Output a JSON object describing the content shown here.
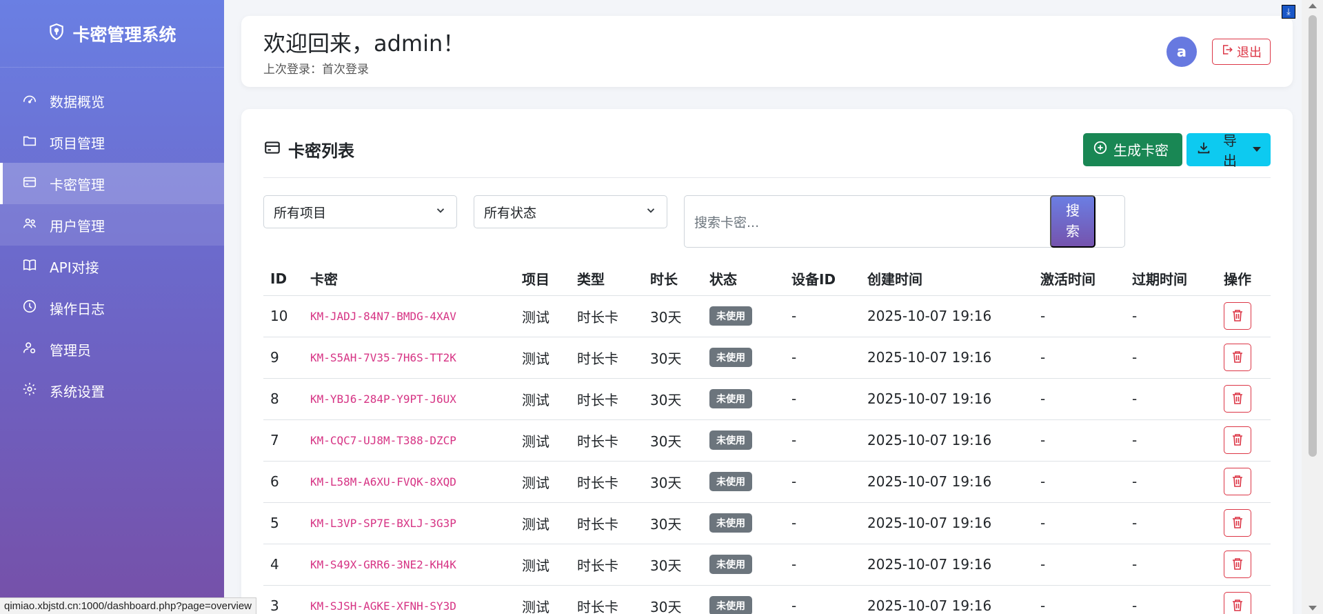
{
  "sidebar": {
    "brand": "卡密管理系统",
    "items": [
      {
        "label": "数据概览",
        "icon": "speedometer-icon"
      },
      {
        "label": "项目管理",
        "icon": "folder-icon"
      },
      {
        "label": "卡密管理",
        "icon": "card-icon"
      },
      {
        "label": "用户管理",
        "icon": "people-icon"
      },
      {
        "label": "API对接",
        "icon": "book-icon"
      },
      {
        "label": "操作日志",
        "icon": "clock-icon"
      },
      {
        "label": "管理员",
        "icon": "admin-icon"
      },
      {
        "label": "系统设置",
        "icon": "gear-icon"
      }
    ]
  },
  "topbar": {
    "welcome": "欢迎回来，admin！",
    "last_login": "上次登录：首次登录",
    "avatar_letter": "a",
    "logout_label": "退出"
  },
  "card": {
    "title": "卡密列表",
    "generate_label": "生成卡密",
    "export_label": "导出"
  },
  "filters": {
    "project_select": "所有项目",
    "status_select": "所有状态",
    "search_placeholder": "搜索卡密...",
    "search_button": "搜索"
  },
  "table": {
    "columns": [
      "ID",
      "卡密",
      "项目",
      "类型",
      "时长",
      "状态",
      "设备ID",
      "创建时间",
      "激活时间",
      "过期时间",
      "操作"
    ],
    "rows": [
      {
        "id": "10",
        "code": "KM-JADJ-84N7-BMDG-4XAV",
        "project": "测试",
        "type": "时长卡",
        "duration": "30天",
        "status": "未使用",
        "device": "-",
        "created": "2025-10-07 19:16",
        "activated": "-",
        "expires": "-"
      },
      {
        "id": "9",
        "code": "KM-S5AH-7V35-7H6S-TT2K",
        "project": "测试",
        "type": "时长卡",
        "duration": "30天",
        "status": "未使用",
        "device": "-",
        "created": "2025-10-07 19:16",
        "activated": "-",
        "expires": "-"
      },
      {
        "id": "8",
        "code": "KM-YBJ6-284P-Y9PT-J6UX",
        "project": "测试",
        "type": "时长卡",
        "duration": "30天",
        "status": "未使用",
        "device": "-",
        "created": "2025-10-07 19:16",
        "activated": "-",
        "expires": "-"
      },
      {
        "id": "7",
        "code": "KM-CQC7-UJ8M-T388-DZCP",
        "project": "测试",
        "type": "时长卡",
        "duration": "30天",
        "status": "未使用",
        "device": "-",
        "created": "2025-10-07 19:16",
        "activated": "-",
        "expires": "-"
      },
      {
        "id": "6",
        "code": "KM-L58M-A6XU-FVQK-8XQD",
        "project": "测试",
        "type": "时长卡",
        "duration": "30天",
        "status": "未使用",
        "device": "-",
        "created": "2025-10-07 19:16",
        "activated": "-",
        "expires": "-"
      },
      {
        "id": "5",
        "code": "KM-L3VP-SP7E-BXLJ-3G3P",
        "project": "测试",
        "type": "时长卡",
        "duration": "30天",
        "status": "未使用",
        "device": "-",
        "created": "2025-10-07 19:16",
        "activated": "-",
        "expires": "-"
      },
      {
        "id": "4",
        "code": "KM-S49X-GRR6-3NE2-KH4K",
        "project": "测试",
        "type": "时长卡",
        "duration": "30天",
        "status": "未使用",
        "device": "-",
        "created": "2025-10-07 19:16",
        "activated": "-",
        "expires": "-"
      },
      {
        "id": "3",
        "code": "KM-SJSH-AGKE-XFNH-SY3D",
        "project": "测试",
        "type": "时长卡",
        "duration": "30天",
        "status": "未使用",
        "device": "-",
        "created": "2025-10-07 19:16",
        "activated": "-",
        "expires": "-"
      }
    ]
  },
  "status_bar": {
    "url": "qimiao.xbjstd.cn:1000/dashboard.php?page=overview"
  },
  "colors": {
    "sidebar_top": "#6a7fe3",
    "sidebar_bottom": "#7650a8",
    "generate_button": "#198754",
    "export_button": "#0dcaf0",
    "danger": "#dc3545",
    "code_text": "#d63384",
    "badge": "#6c757d"
  }
}
